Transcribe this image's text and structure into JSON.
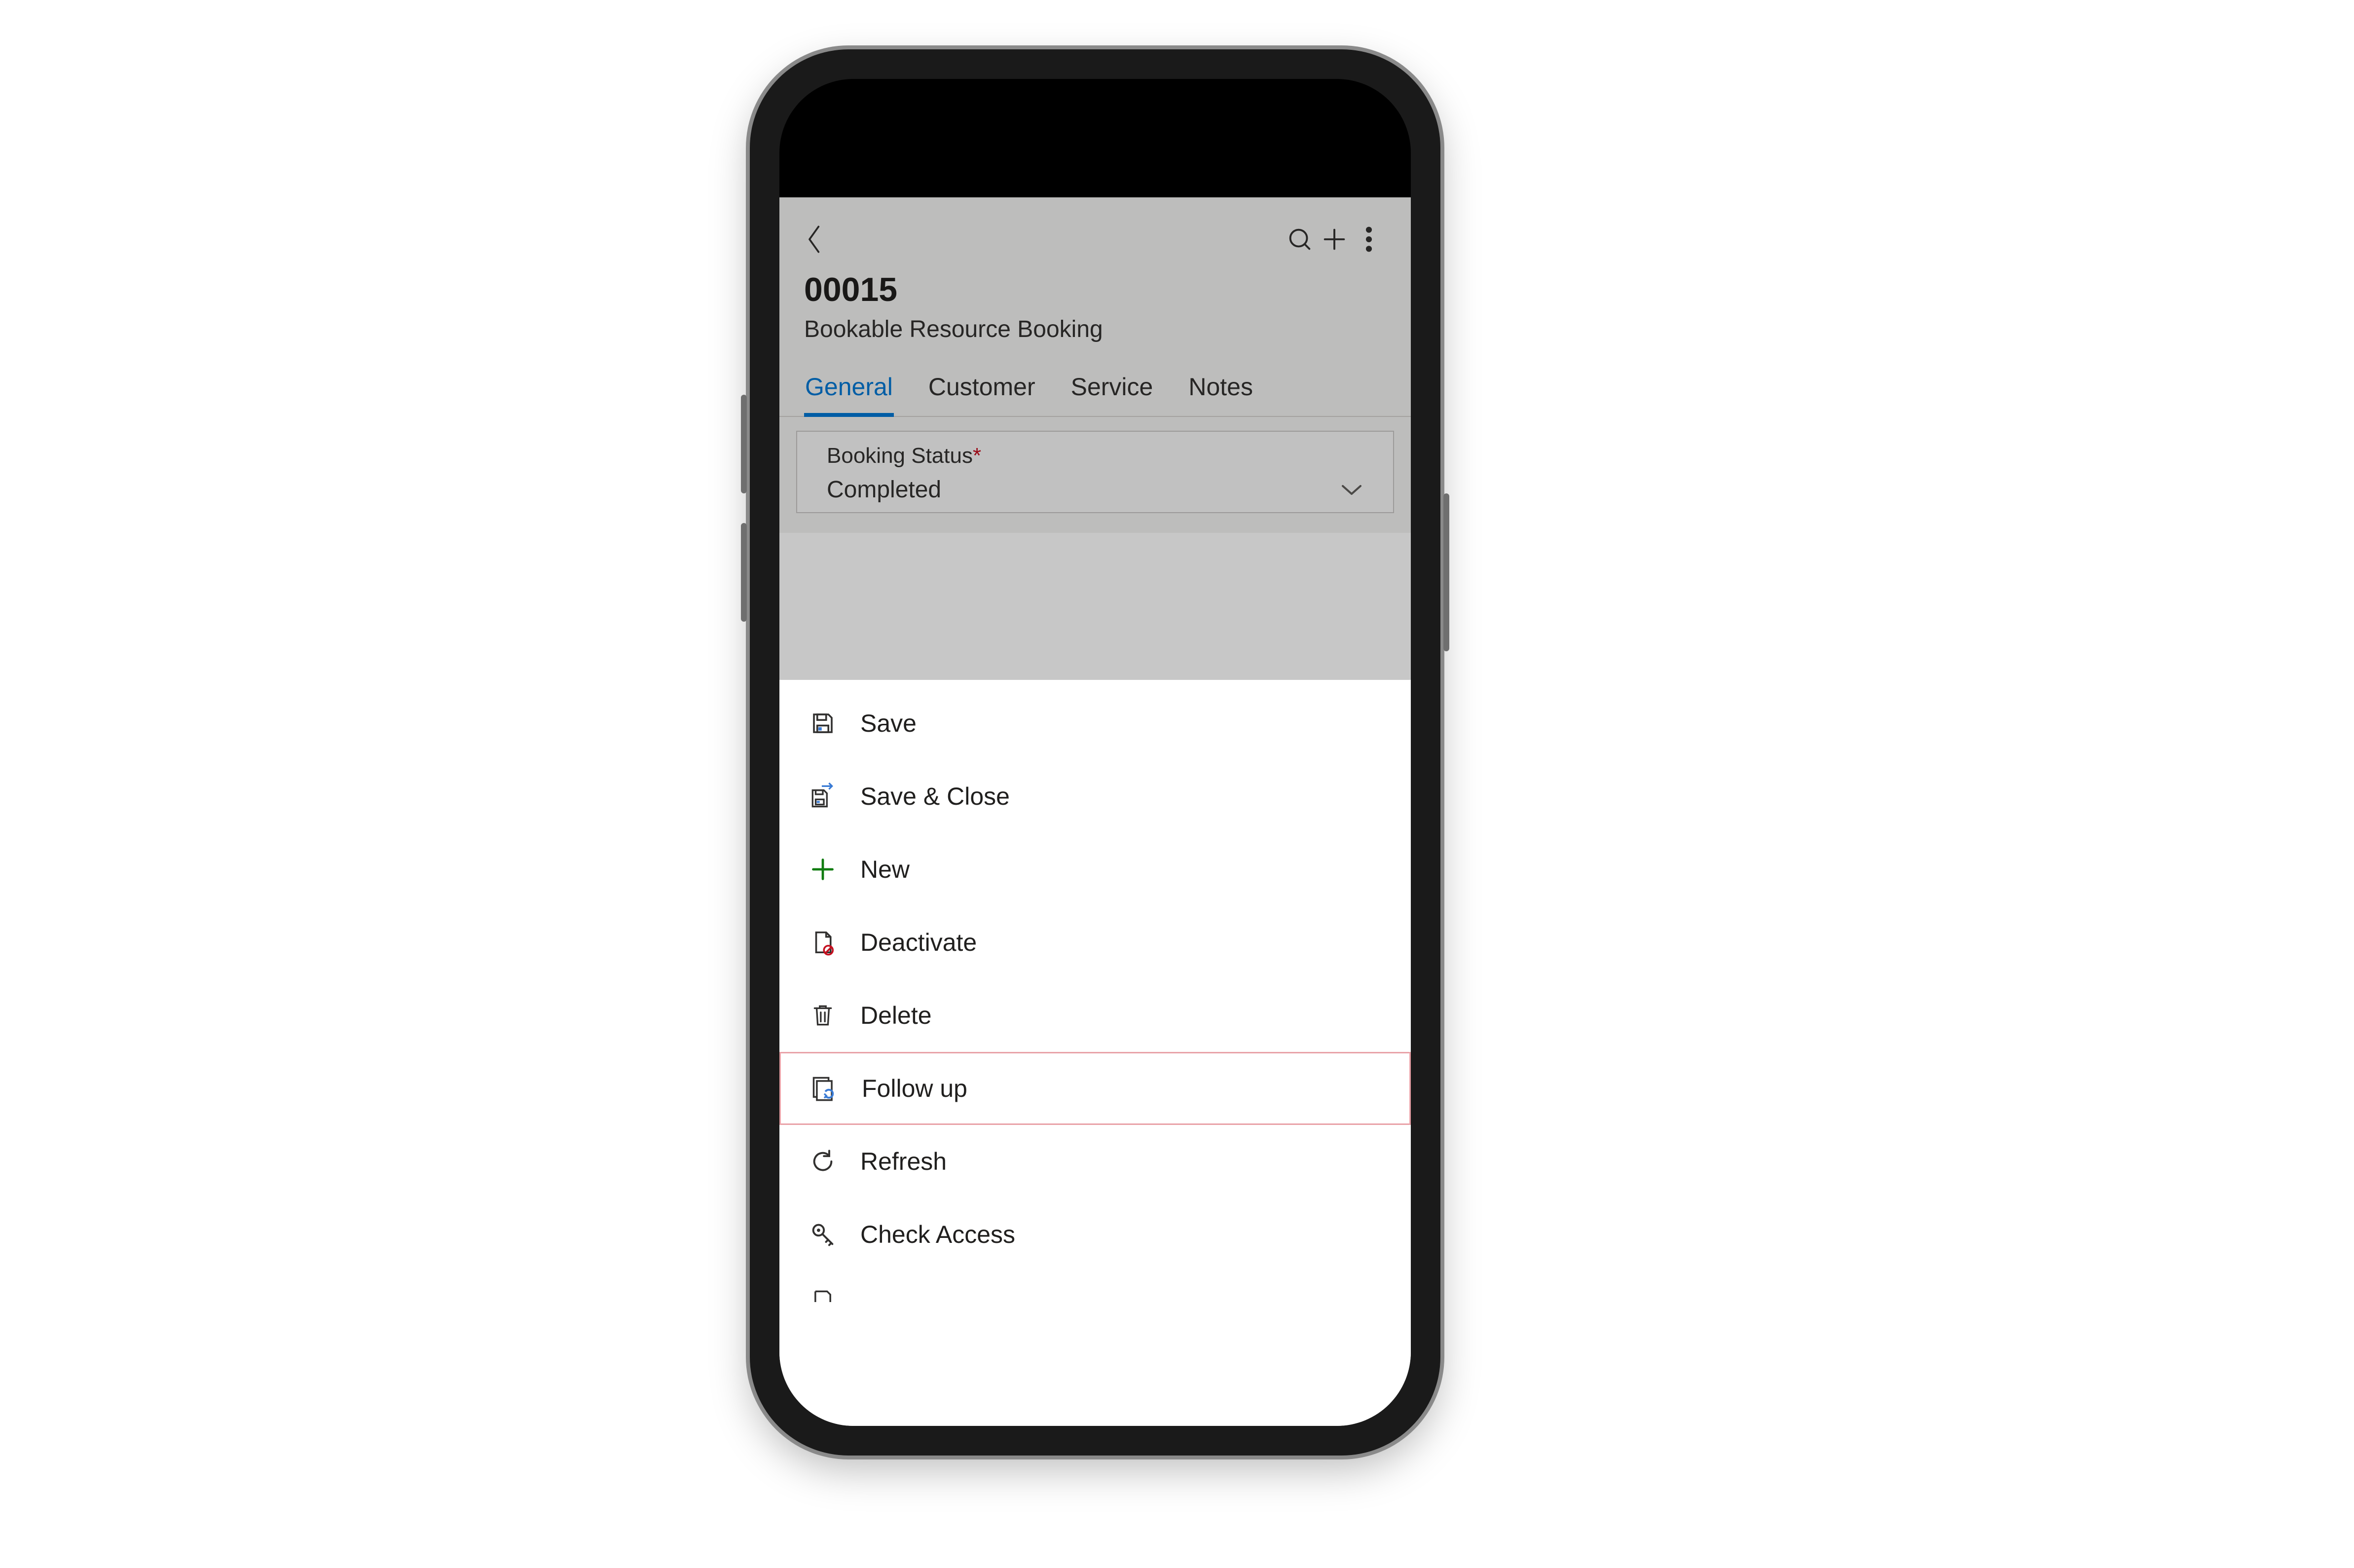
{
  "header": {
    "title": "00015",
    "subtitle": "Bookable Resource Booking"
  },
  "tabs": [
    {
      "label": "General",
      "active": true
    },
    {
      "label": "Customer",
      "active": false
    },
    {
      "label": "Service",
      "active": false
    },
    {
      "label": "Notes",
      "active": false
    }
  ],
  "field": {
    "label": "Booking Status",
    "required_marker": "*",
    "value": "Completed"
  },
  "menu": {
    "items": [
      {
        "icon": "save-icon",
        "label": "Save"
      },
      {
        "icon": "save-close-icon",
        "label": "Save & Close"
      },
      {
        "icon": "new-icon",
        "label": "New"
      },
      {
        "icon": "deactivate-icon",
        "label": "Deactivate"
      },
      {
        "icon": "delete-icon",
        "label": "Delete"
      },
      {
        "icon": "followup-icon",
        "label": "Follow up",
        "highlight": true
      },
      {
        "icon": "refresh-icon",
        "label": "Refresh"
      },
      {
        "icon": "check-access-icon",
        "label": "Check Access"
      }
    ]
  }
}
